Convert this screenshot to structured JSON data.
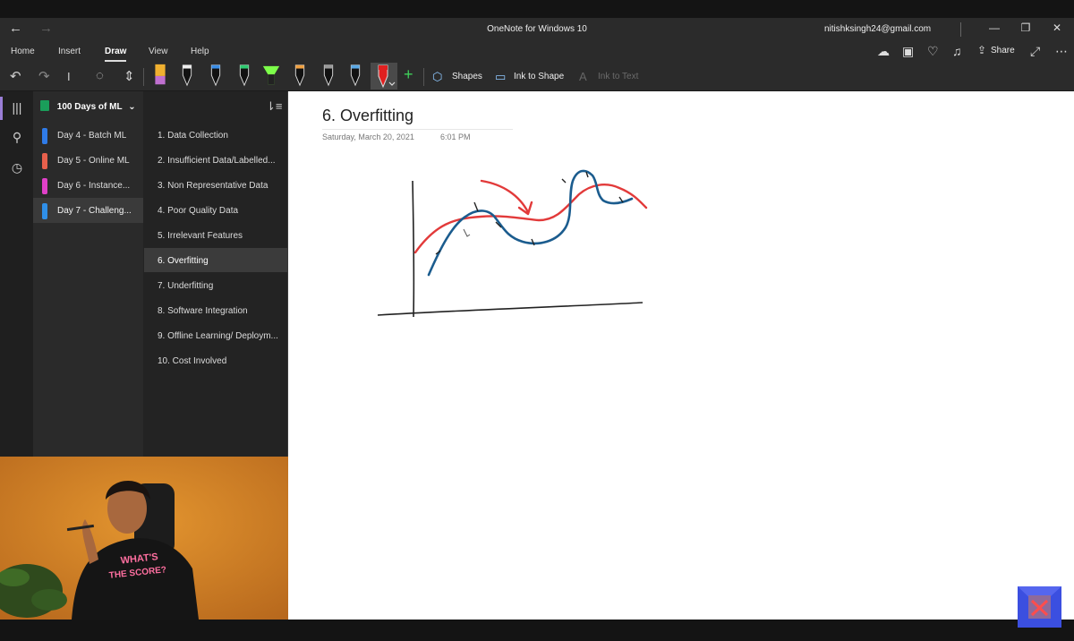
{
  "window": {
    "title": "OneNote for Windows 10",
    "account": "nitishksingh24@gmail.com"
  },
  "menu": {
    "items": [
      "Home",
      "Insert",
      "Draw",
      "View",
      "Help"
    ],
    "active": "Draw",
    "share_label": "Share"
  },
  "toolbar": {
    "shapes_label": "Shapes",
    "ink_to_shape_label": "Ink to Shape",
    "ink_to_text_label": "Ink to Text",
    "pen_colors": [
      "#c070d0",
      "#111111",
      "#3a8ee8",
      "#2ecc71",
      "#7dff4a",
      "#f0a040",
      "#888888",
      "#5aa9e6",
      "#e02020"
    ]
  },
  "notebook": {
    "name": "100 Days of ML",
    "sections": [
      {
        "label": "Day 4 - Batch ML",
        "color": "#2f7be8"
      },
      {
        "label": "Day 5 - Online ML",
        "color": "#e8604c"
      },
      {
        "label": "Day 6 - Instance...",
        "color": "#e040c8"
      },
      {
        "label": "Day 7 - Challeng...",
        "color": "#2f8fe8"
      }
    ],
    "selected_section": 3
  },
  "pages": {
    "items": [
      "1. Data Collection",
      "2. Insufficient Data/Labelled...",
      "3. Non Representative Data",
      "4. Poor Quality Data",
      "5. Irrelevant Features",
      "6. Overfitting",
      "7. Underfitting",
      "8. Software Integration",
      "9. Offline Learning/ Deploym...",
      "10. Cost Involved"
    ],
    "selected": 5
  },
  "page": {
    "title": "6. Overfitting",
    "date": "Saturday, March 20, 2021",
    "time": "6:01 PM"
  },
  "webcam": {
    "shirt_text_line1": "WHAT'S",
    "shirt_text_line2": "THE SCORE?"
  }
}
